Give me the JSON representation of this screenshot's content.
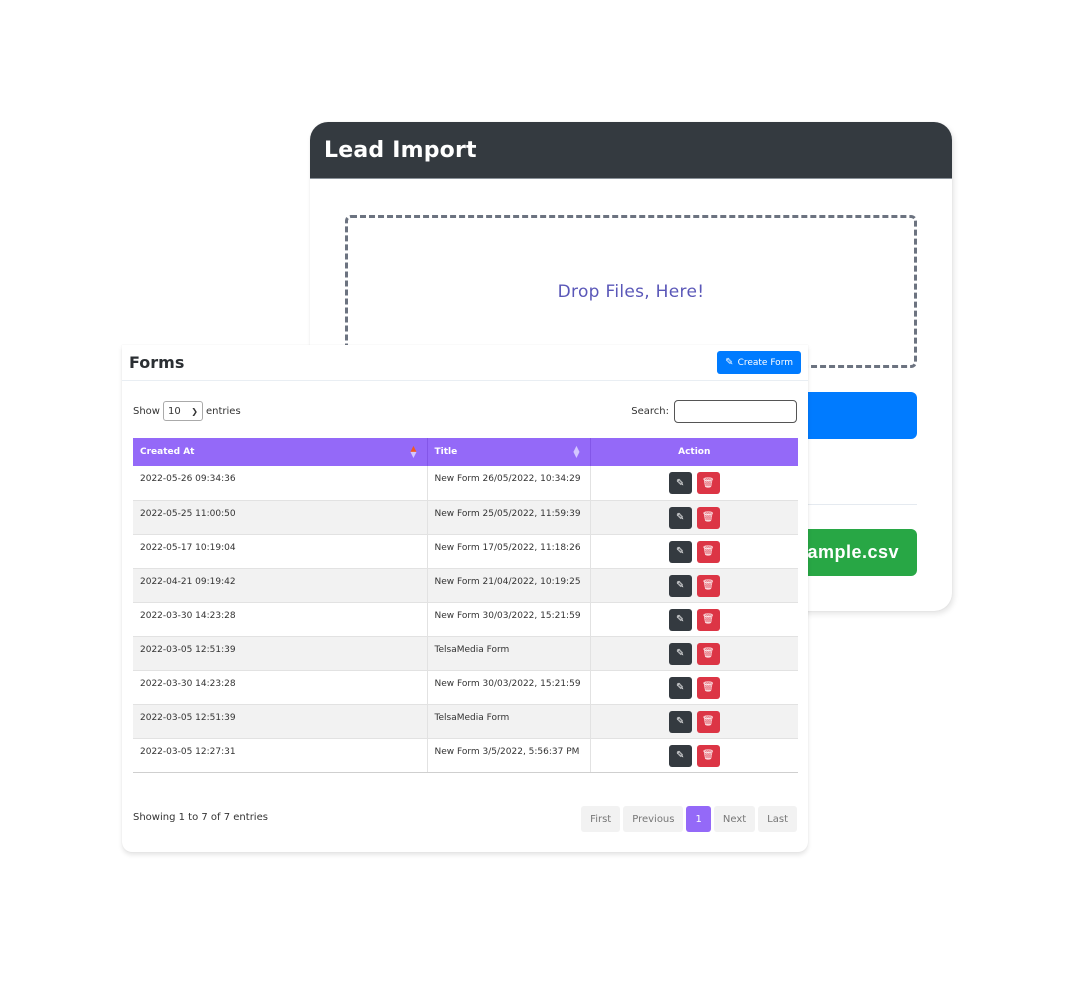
{
  "lead_import": {
    "title": "Lead Import",
    "dropzone_text": "Drop Files, Here!",
    "upload_button_label": "",
    "sample_button_label": "ample.csv"
  },
  "forms": {
    "title": "Forms",
    "create_button_label": "Create Form",
    "create_button_icon": "edit-icon",
    "show_label": "Show",
    "entries_label": "entries",
    "page_length": "10",
    "search_label": "Search:",
    "search_value": "",
    "columns": [
      "Created At",
      "Title",
      "Action"
    ],
    "sorted_column": "Created At",
    "rows": [
      {
        "created_at": "2022-05-26 09:34:36",
        "title": "New Form 26/05/2022, 10:34:29"
      },
      {
        "created_at": "2022-05-25 11:00:50",
        "title": "New Form 25/05/2022, 11:59:39"
      },
      {
        "created_at": "2022-05-17 10:19:04",
        "title": "New Form 17/05/2022, 11:18:26"
      },
      {
        "created_at": "2022-04-21 09:19:42",
        "title": "New Form 21/04/2022, 10:19:25"
      },
      {
        "created_at": "2022-03-30 14:23:28",
        "title": "New Form 30/03/2022, 15:21:59"
      },
      {
        "created_at": "2022-03-05 12:51:39",
        "title": "TelsaMedia Form"
      },
      {
        "created_at": "2022-03-30 14:23:28",
        "title": "New Form 30/03/2022, 15:21:59"
      },
      {
        "created_at": "2022-03-05 12:51:39",
        "title": "TelsaMedia Form"
      },
      {
        "created_at": "2022-03-05 12:27:31",
        "title": "New Form 3/5/2022, 5:56:37 PM"
      }
    ],
    "row_actions": {
      "edit_icon": "pencil-icon",
      "delete_icon": "trash-icon"
    },
    "info": "Showing 1 to 7 of 7 entries",
    "pagination": {
      "first": "First",
      "previous": "Previous",
      "current": "1",
      "next": "Next",
      "last": "Last"
    }
  },
  "colors": {
    "header_dark": "#343a40",
    "primary": "#007bff",
    "success": "#28a745",
    "danger": "#dc3545",
    "table_header": "#9469f8",
    "dropzone_text": "#5a57b8"
  }
}
